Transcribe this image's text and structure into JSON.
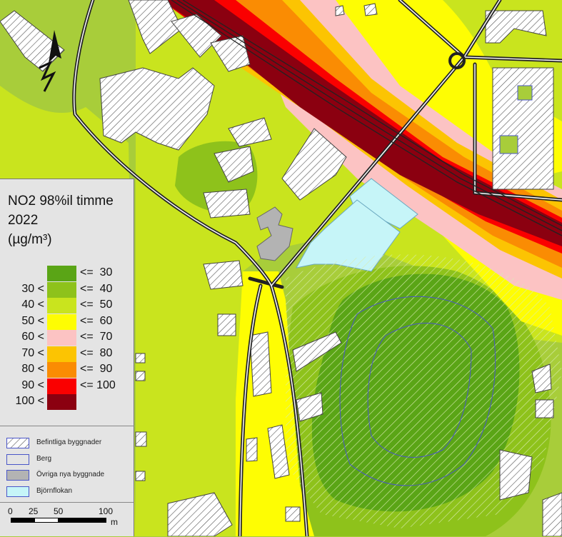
{
  "colors": {
    "c30": "#5aa516",
    "c40": "#8ec21b",
    "c50": "#c9e41e",
    "c60": "#fefd03",
    "c70": "#fcc3c3",
    "c80": "#fcc402",
    "c90": "#fa8c03",
    "c100": "#fa0000",
    "cmax": "#8b0010",
    "berg": "#4a56c8",
    "ovriga": "#b3b3b3",
    "bjornflokan": "#c6f5f8"
  },
  "north_arrow": {
    "icon": "north-arrow-icon",
    "label": "N"
  },
  "legend": {
    "title_line1": "NO2 98%il timme",
    "title_line2": "2022",
    "title_line3": "(µg/m³)",
    "classes": [
      {
        "lower": "",
        "upper": "<=  30",
        "color": "#5aa516"
      },
      {
        "lower": "30 <",
        "upper": "<=  40",
        "color": "#8ec21b"
      },
      {
        "lower": "40 <",
        "upper": "<=  50",
        "color": "#c9e41e"
      },
      {
        "lower": "50 <",
        "upper": "<=  60",
        "color": "#fefd03"
      },
      {
        "lower": "60 <",
        "upper": "<=  70",
        "color": "#fcc3c3"
      },
      {
        "lower": "70 <",
        "upper": "<=  80",
        "color": "#fcc402"
      },
      {
        "lower": "80 <",
        "upper": "<=  90",
        "color": "#fa8c03"
      },
      {
        "lower": "90 <",
        "upper": "<= 100",
        "color": "#fa0000"
      },
      {
        "lower": "100 <",
        "upper": "",
        "color": "#8b0010"
      }
    ],
    "categories": [
      {
        "label": "Befintliga byggnader",
        "icon": "hatched-building-icon"
      },
      {
        "label": "Berg",
        "icon": "berg-outline-icon"
      },
      {
        "label": "Övriga nya byggnade",
        "icon": "grey-building-icon"
      },
      {
        "label": "Björnflokan",
        "icon": "cyan-area-icon"
      }
    ]
  },
  "scale_bar": {
    "ticks": [
      "0",
      "25",
      "50",
      "100"
    ],
    "unit": "m"
  }
}
